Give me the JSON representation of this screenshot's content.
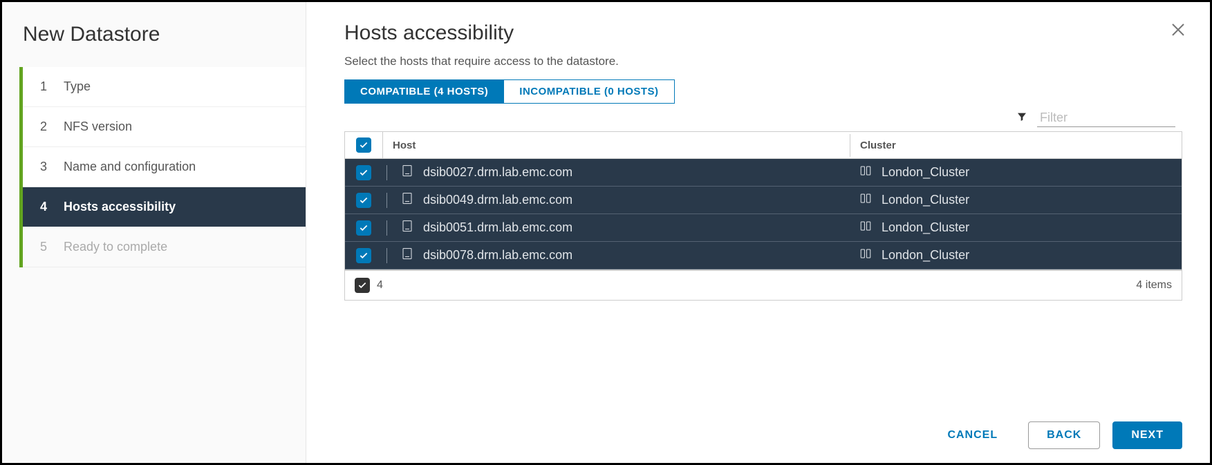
{
  "sidebar": {
    "title": "New Datastore",
    "steps": [
      {
        "num": "1",
        "label": "Type"
      },
      {
        "num": "2",
        "label": "NFS version"
      },
      {
        "num": "3",
        "label": "Name and configuration"
      },
      {
        "num": "4",
        "label": "Hosts accessibility"
      },
      {
        "num": "5",
        "label": "Ready to complete"
      }
    ]
  },
  "main": {
    "title": "Hosts accessibility",
    "subtitle": "Select the hosts that require access to the datastore.",
    "tabs": {
      "compatible": "COMPATIBLE (4 HOSTS)",
      "incompatible": "INCOMPATIBLE (0 HOSTS)"
    },
    "filter_placeholder": "Filter",
    "table": {
      "col_host": "Host",
      "col_cluster": "Cluster",
      "rows": [
        {
          "host": "dsib0027.drm.lab.emc.com",
          "cluster": "London_Cluster"
        },
        {
          "host": "dsib0049.drm.lab.emc.com",
          "cluster": "London_Cluster"
        },
        {
          "host": "dsib0051.drm.lab.emc.com",
          "cluster": "London_Cluster"
        },
        {
          "host": "dsib0078.drm.lab.emc.com",
          "cluster": "London_Cluster"
        }
      ],
      "selected_count": "4",
      "items_label": "4 items"
    }
  },
  "footer": {
    "cancel": "CANCEL",
    "back": "BACK",
    "next": "NEXT"
  }
}
